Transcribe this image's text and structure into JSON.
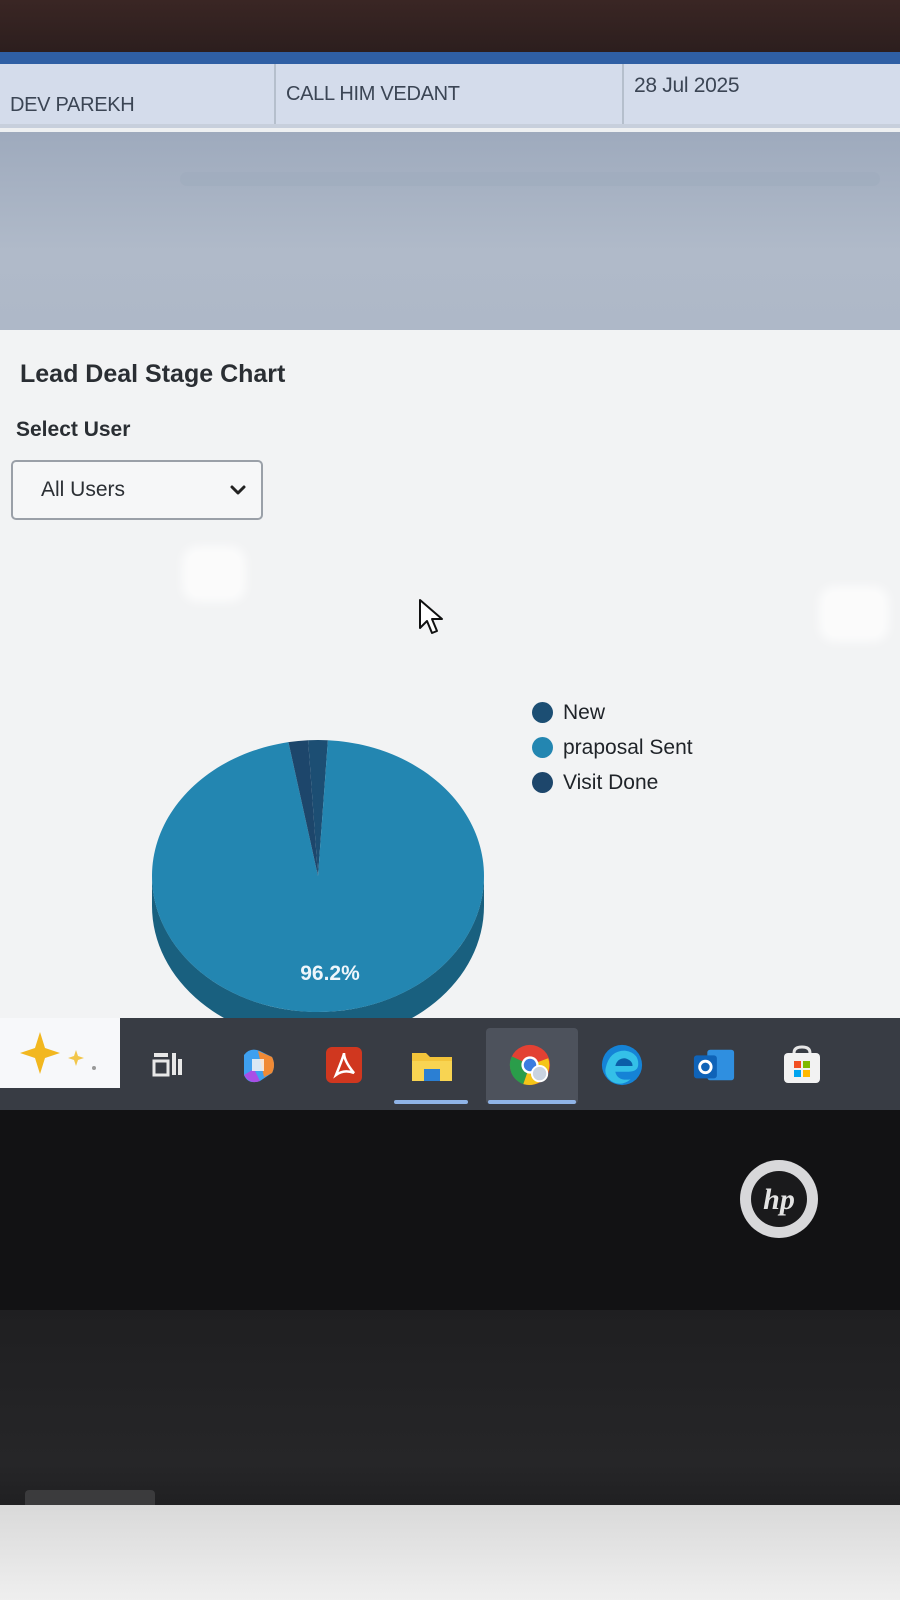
{
  "table_row": {
    "name": "DEV PAREKH",
    "remark": "CALL HIM VEDANT",
    "date": "28 Jul 2025"
  },
  "chart_section": {
    "title": "Lead Deal Stage Chart",
    "select_label": "Select User",
    "select_value": "All Users"
  },
  "chart_data": {
    "type": "pie",
    "categories": [
      "New",
      "praposal Sent",
      "Visit Done"
    ],
    "values": [
      1.9,
      96.2,
      1.9
    ],
    "data_labels": [
      "",
      "96.2%",
      ""
    ],
    "colors": [
      "#1c4e73",
      "#2386b1",
      "#1d466b"
    ],
    "legend_position": "right",
    "style": "3d"
  },
  "taskbar": {
    "icons": [
      "copilot-sparkle-icon",
      "widgets-icon",
      "copilot-icon",
      "acrobat-icon",
      "file-explorer-icon",
      "chrome-icon",
      "edge-icon",
      "outlook-icon",
      "store-icon"
    ],
    "active": "chrome-icon"
  },
  "device": {
    "logo": "hp"
  }
}
